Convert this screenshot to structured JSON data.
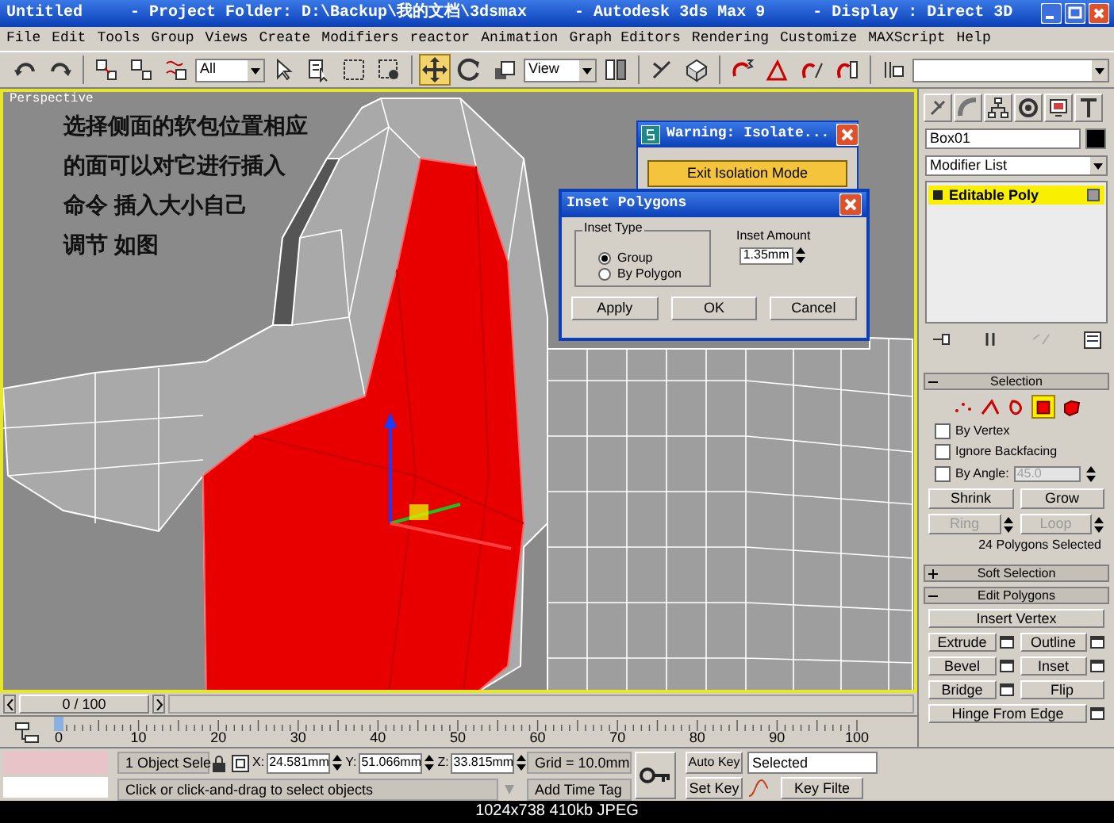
{
  "window": {
    "title": "Untitled     - Project Folder: D:\\Backup\\我的文档\\3dsmax     - Autodesk 3ds Max 9     - Display : Direct 3D"
  },
  "menu": [
    "File",
    "Edit",
    "Tools",
    "Group",
    "Views",
    "Create",
    "Modifiers",
    "reactor",
    "Animation",
    "Graph Editors",
    "Rendering",
    "Customize",
    "MAXScript",
    "Help"
  ],
  "toolbar": {
    "selection_filter": "All",
    "reference_coordinate": "View"
  },
  "viewport": {
    "label": "Perspective",
    "annotation": [
      "选择侧面的软包位置相应",
      "的面可以对它进行插入",
      "命令 插入大小自己",
      "调节 如图"
    ]
  },
  "warning_dialog": {
    "title": "Warning: Isolate...",
    "button": "Exit Isolation Mode"
  },
  "inset_dialog": {
    "title": "Inset Polygons",
    "group": "Inset Type",
    "options": [
      {
        "label": "Group",
        "selected": true
      },
      {
        "label": "By Polygon",
        "selected": false
      }
    ],
    "amount_label": "Inset Amount",
    "amount": "1.35mm",
    "buttons": [
      "Apply",
      "OK",
      "Cancel"
    ]
  },
  "command_panel": {
    "object_name": "Box01",
    "modifier_list": "Modifier List",
    "stack": [
      {
        "label": "Editable Poly",
        "selected": true
      }
    ]
  },
  "selection_rollout": {
    "title": "Selection",
    "expanded": true,
    "subobject_levels": [
      {
        "kind": "vertex",
        "selected": false
      },
      {
        "kind": "edge",
        "selected": false
      },
      {
        "kind": "border",
        "selected": false
      },
      {
        "kind": "polygon",
        "selected": true
      },
      {
        "kind": "element",
        "selected": false
      }
    ],
    "by_vertex": {
      "label": "By Vertex",
      "checked": false
    },
    "ignore_backfacing": {
      "label": "Ignore Backfacing",
      "checked": false
    },
    "by_angle": {
      "label": "By Angle:",
      "checked": false,
      "value": "45.0",
      "disabled": true
    },
    "buttons": [
      {
        "label": "Shrink",
        "disabled": false
      },
      {
        "label": "Grow",
        "disabled": false
      },
      {
        "label": "Ring",
        "disabled": true
      },
      {
        "label": "Loop",
        "disabled": true
      }
    ],
    "status": "24 Polygons Selected"
  },
  "soft_selection_rollout": {
    "title": "Soft Selection",
    "expanded": false
  },
  "edit_polygons_rollout": {
    "title": "Edit Polygons",
    "expanded": true,
    "buttons": [
      {
        "label": "Insert Vertex",
        "kind": "full",
        "settings": false
      },
      {
        "label": "Extrude",
        "kind": "half",
        "settings": true
      },
      {
        "label": "Outline",
        "kind": "half",
        "settings": true
      },
      {
        "label": "Bevel",
        "kind": "half",
        "settings": true
      },
      {
        "label": "Inset",
        "kind": "half",
        "settings": true
      },
      {
        "label": "Bridge",
        "kind": "half",
        "settings": true
      },
      {
        "label": "Flip",
        "kind": "half",
        "settings": false
      },
      {
        "label": "Hinge From Edge",
        "kind": "full",
        "settings": true
      }
    ]
  },
  "time_slider": {
    "position": "0 / 100"
  },
  "track_bar": {
    "labels": [
      "0",
      "10",
      "20",
      "30",
      "40",
      "50",
      "60",
      "70",
      "80",
      "90",
      "100"
    ]
  },
  "status_bar": {
    "selection": "1 Object Sele",
    "coordinates": [
      {
        "label": "X:",
        "value": "24.581mm"
      },
      {
        "label": "Y:",
        "value": "51.066mm"
      },
      {
        "label": "Z:",
        "value": "33.815mm"
      }
    ],
    "grid": "Grid = 10.0mm",
    "prompt": "Click or click-and-drag to select objects",
    "add_time_tag": "Add Time Tag",
    "auto_key": "Auto Key",
    "set_key": "Set Key",
    "key_mode": "Selected",
    "key_filters": "Key Filte"
  },
  "image_caption": "1024x738 410kb JPEG"
}
